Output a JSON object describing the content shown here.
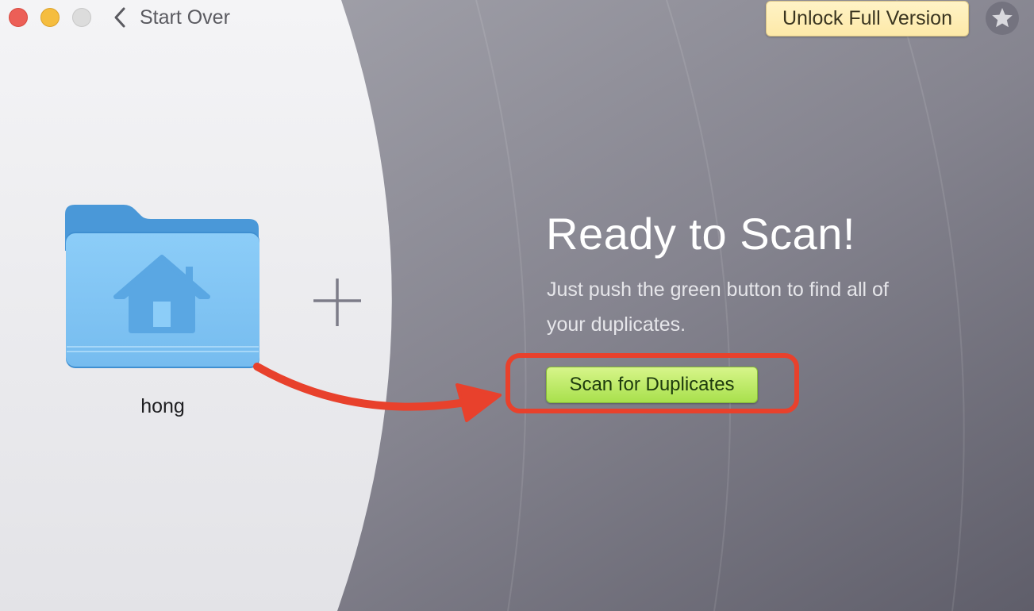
{
  "window": {
    "controls": [
      "close",
      "minimize",
      "zoom"
    ]
  },
  "toolbar": {
    "back_icon": "chevron-left-icon",
    "back_label": "Start Over",
    "unlock_label": "Unlock Full Version",
    "favorite_icon": "star-icon"
  },
  "source": {
    "folder_icon": "home-folder-icon",
    "folder_name": "hong",
    "add_icon": "plus-icon"
  },
  "main": {
    "heading": "Ready to Scan!",
    "subtext": "Just push the green button to find all of your duplicates.",
    "scan_button_label": "Scan for Duplicates"
  },
  "annotation": {
    "arrow_color": "#e8412c",
    "highlight_color": "#e8412c"
  },
  "colors": {
    "scan_button": "#b9e866",
    "unlock_button": "#fdefb8",
    "folder_blue": "#7ec5f5"
  }
}
